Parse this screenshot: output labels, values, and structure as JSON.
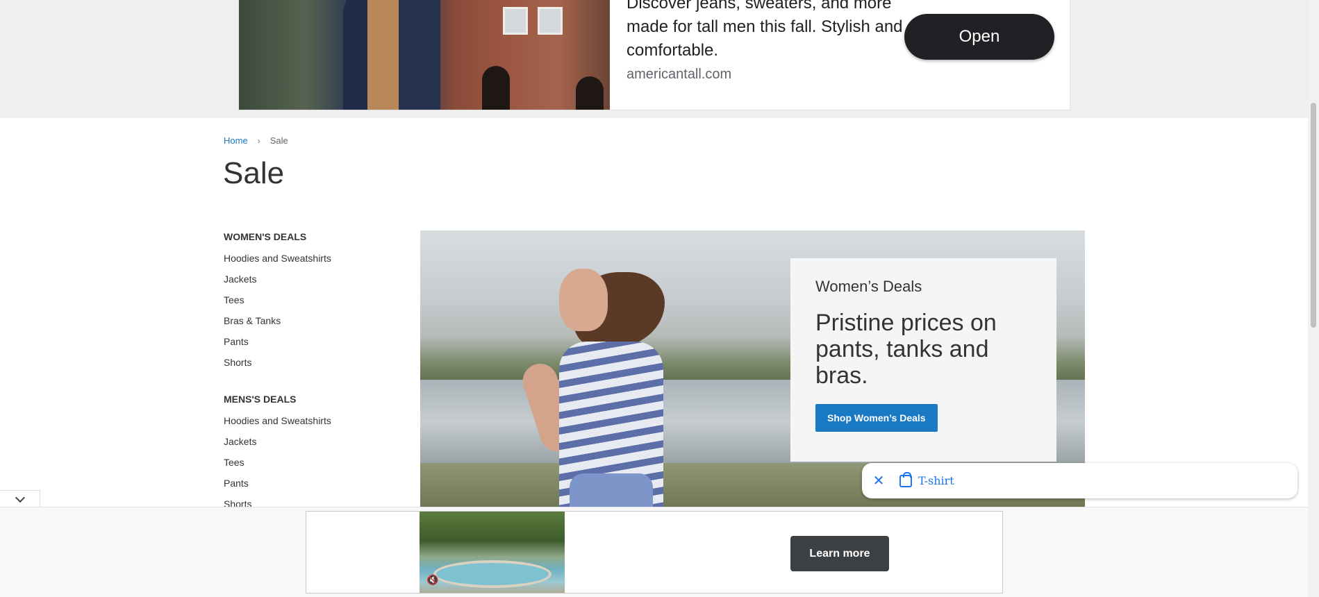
{
  "top_ad": {
    "text": "Discover jeans, sweaters, and more made for tall men this fall. Stylish and comfortable.",
    "url": "americantall.com",
    "button_label": "Open"
  },
  "breadcrumb": {
    "home": "Home",
    "separator": "›",
    "current": "Sale"
  },
  "page_title": "Sale",
  "sidebar": {
    "womens": {
      "heading": "WOMEN'S DEALS",
      "items": [
        "Hoodies and Sweatshirts",
        "Jackets",
        "Tees",
        "Bras & Tanks",
        "Pants",
        "Shorts"
      ]
    },
    "mens": {
      "heading": "MENS'S DEALS",
      "items": [
        "Hoodies and Sweatshirts",
        "Jackets",
        "Tees",
        "Pants",
        "Shorts"
      ]
    }
  },
  "hero": {
    "kicker": "Women’s Deals",
    "headline": "Pristine prices on pants, tanks and bras.",
    "button_label": "Shop Women’s Deals"
  },
  "chip": {
    "close_icon": "close-icon",
    "bag_icon": "shopping-bag-icon",
    "label": "T-shirt"
  },
  "bottom_ad": {
    "button_label": "Learn more",
    "mute_icon": "mute-icon"
  },
  "colors": {
    "link": "#1979c3",
    "primary_button": "#1979c3",
    "chip_text": "#1a73e8",
    "ad_button": "#202124"
  }
}
